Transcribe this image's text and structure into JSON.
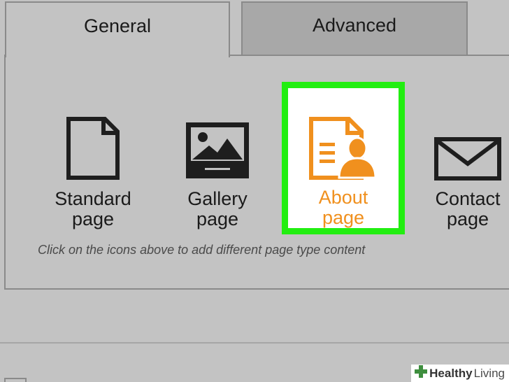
{
  "tabs": [
    {
      "label": "General",
      "active": true
    },
    {
      "label": "Advanced",
      "active": false
    }
  ],
  "page_types": [
    {
      "line1": "Standard",
      "line2": "page",
      "icon": "document-icon"
    },
    {
      "line1": "Gallery",
      "line2": "page",
      "icon": "gallery-icon"
    },
    {
      "line1": "About",
      "line2": "page",
      "icon": "about-person-icon",
      "selected": true
    },
    {
      "line1": "Contact",
      "line2": "page",
      "icon": "envelope-icon"
    }
  ],
  "hint": "Click on the icons above to add different page type content",
  "watermark": {
    "part1": "Healthy",
    "part2": " Living",
    "logo": "plus-logo"
  },
  "colors": {
    "background": "#c3c3c3",
    "inactive_tab": "#a8a8a8",
    "selection_border": "#22ee11",
    "about_accent": "#f0901e",
    "icon_dark": "#1e1e1e"
  }
}
